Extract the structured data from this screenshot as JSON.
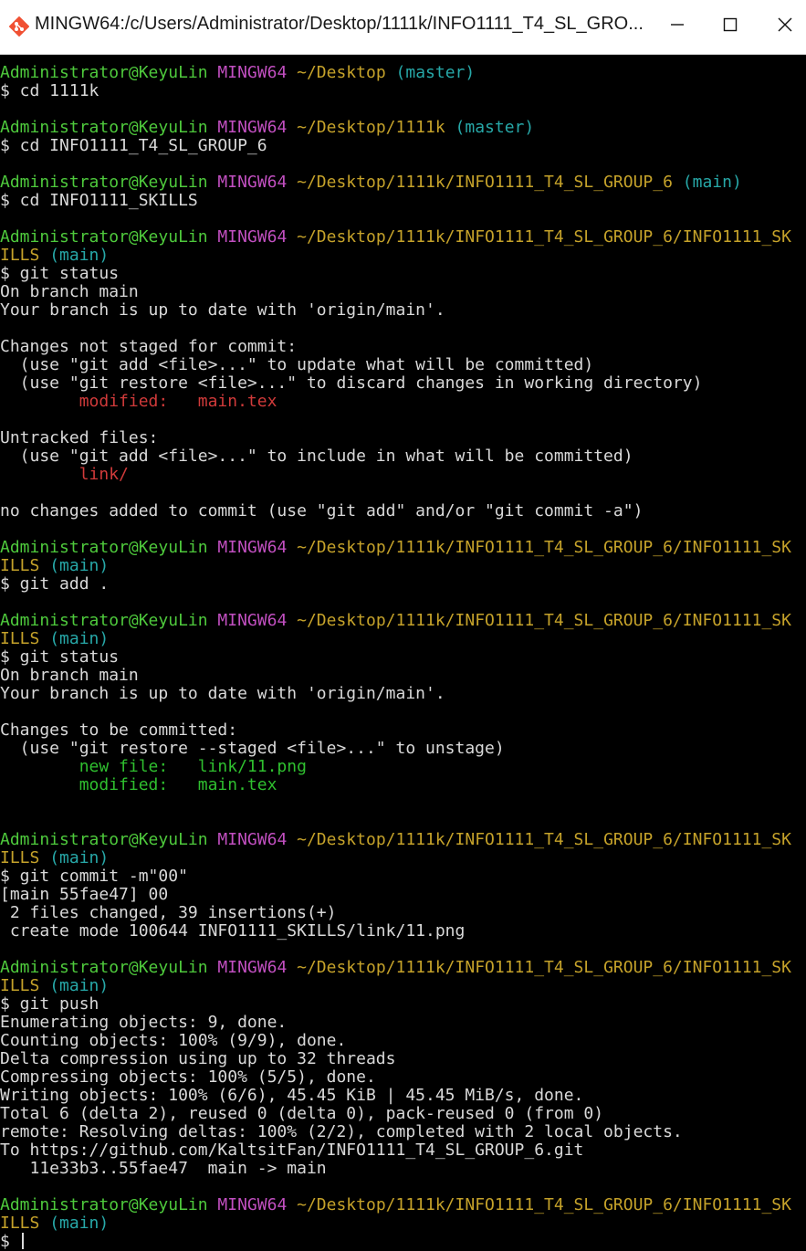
{
  "window": {
    "title": "MINGW64:/c/Users/Administrator/Desktop/1111k/INFO1111_T4_SL_GRO..."
  },
  "colors": {
    "user_host": "#4ec93c",
    "msystem": "#c14fc0",
    "path": "#c5a22a",
    "branch": "#27a8a8",
    "unstaged": "#d03a3a",
    "staged": "#2fbf2f",
    "text": "#d9d9d9",
    "background": "#000000"
  },
  "icons": {
    "app": "git-bash-icon",
    "minimize": "minimize-icon",
    "maximize": "maximize-icon",
    "close": "close-icon"
  },
  "terminal": {
    "user_host": "Administrator@KeyuLin",
    "msystem": "MINGW64",
    "blocks": [
      {
        "path": "~/Desktop",
        "branch": "(master)",
        "command": "$ cd 1111k",
        "output": []
      },
      {
        "path": "~/Desktop/1111k",
        "branch": "(master)",
        "command": "$ cd INFO1111_T4_SL_GROUP_6",
        "output": []
      },
      {
        "path": "~/Desktop/1111k/INFO1111_T4_SL_GROUP_6",
        "branch": "(main)",
        "command": "$ cd INFO1111_SKILLS",
        "output": []
      },
      {
        "path": "~/Desktop/1111k/INFO1111_T4_SL_GROUP_6/INFO1111_SK",
        "path_wrap": "ILLS",
        "branch": "(main)",
        "command": "$ git status",
        "output": [
          "On branch main",
          "Your branch is up to date with 'origin/main'.",
          "",
          "Changes not staged for commit:",
          "  (use \"git add <file>...\" to update what will be committed)",
          "  (use \"git restore <file>...\" to discard changes in working directory)",
          "        modified:   main.tex",
          "",
          "Untracked files:",
          "  (use \"git add <file>...\" to include in what will be committed)",
          "        link/",
          "",
          "no changes added to commit (use \"git add\" and/or \"git commit -a\")"
        ]
      },
      {
        "path": "~/Desktop/1111k/INFO1111_T4_SL_GROUP_6/INFO1111_SK",
        "path_wrap": "ILLS",
        "branch": "(main)",
        "command": "$ git add .",
        "output": []
      },
      {
        "path": "~/Desktop/1111k/INFO1111_T4_SL_GROUP_6/INFO1111_SK",
        "path_wrap": "ILLS",
        "branch": "(main)",
        "command": "$ git status",
        "output": [
          "On branch main",
          "Your branch is up to date with 'origin/main'.",
          "",
          "Changes to be committed:",
          "  (use \"git restore --staged <file>...\" to unstage)",
          "        new file:   link/11.png",
          "        modified:   main.tex",
          ""
        ]
      },
      {
        "path": "~/Desktop/1111k/INFO1111_T4_SL_GROUP_6/INFO1111_SK",
        "path_wrap": "ILLS",
        "branch": "(main)",
        "command": "$ git commit -m\"00\"",
        "output": [
          "[main 55fae47] 00",
          " 2 files changed, 39 insertions(+)",
          " create mode 100644 INFO1111_SKILLS/link/11.png"
        ]
      },
      {
        "path": "~/Desktop/1111k/INFO1111_T4_SL_GROUP_6/INFO1111_SK",
        "path_wrap": "ILLS",
        "branch": "(main)",
        "command": "$ git push",
        "output": [
          "Enumerating objects: 9, done.",
          "Counting objects: 100% (9/9), done.",
          "Delta compression using up to 32 threads",
          "Compressing objects: 100% (5/5), done.",
          "Writing objects: 100% (6/6), 45.45 KiB | 45.45 MiB/s, done.",
          "Total 6 (delta 2), reused 0 (delta 0), pack-reused 0 (from 0)",
          "remote: Resolving deltas: 100% (2/2), completed with 2 local objects.",
          "To https://github.com/KaltsitFan/INFO1111_T4_SL_GROUP_6.git",
          "   11e33b3..55fae47  main -> main"
        ]
      },
      {
        "path": "~/Desktop/1111k/INFO1111_T4_SL_GROUP_6/INFO1111_SK",
        "path_wrap": "ILLS",
        "branch": "(main)",
        "command": "$ ",
        "output": []
      }
    ],
    "highlights": {
      "unstaged": [
        "        modified:   main.tex",
        "        link/"
      ],
      "staged": [
        "        new file:   link/11.png",
        "        modified:   main.tex"
      ]
    }
  }
}
